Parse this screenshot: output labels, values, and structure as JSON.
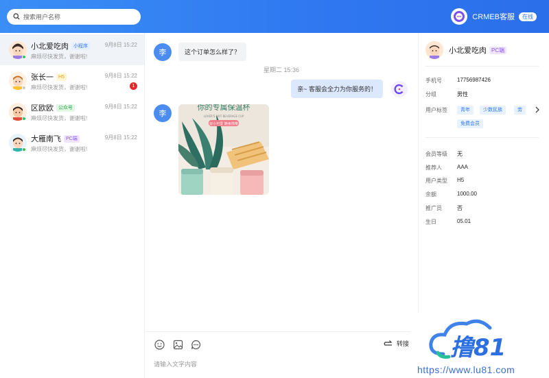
{
  "search": {
    "placeholder": "搜索用户名称"
  },
  "brand": {
    "name": "CRMEB客服",
    "status": "在线"
  },
  "conversations": [
    {
      "name": "小北爱吃肉",
      "tag": "小程序",
      "time": "9月8日 15:22",
      "msg": "麻烦尽快发货，谢谢啦!",
      "status_color": "#2ec45c"
    },
    {
      "name": "张长一",
      "tag": "H5",
      "time": "9月8日 15:22",
      "msg": "麻烦尽快发货，谢谢啦!",
      "badge": "1",
      "status_color": "#c8c8c8"
    },
    {
      "name": "区欧欧",
      "tag": "公众号",
      "time": "9月8日 15:22",
      "msg": "麻烦尽快发货，谢谢啦!",
      "status_color": "#2ec45c"
    },
    {
      "name": "大雁南飞",
      "tag": "PC端",
      "time": "9月8日 15:22",
      "msg": "麻烦尽快发货，谢谢啦!",
      "status_color": "#2ec45c"
    }
  ],
  "chat": {
    "user_initial": "李",
    "msg1": "这个订单怎么样了？",
    "time_divider": "星期二 15:36",
    "msg2": "亲~ 客服会全力为你服务的！",
    "image_title": "你的专属保温杯",
    "image_subtitle": "LOVER'S HOT BEVERAGE CUP",
    "image_badge": "好小可爱 随身携带",
    "input_placeholder": "请输入文字内容",
    "transfer_label": "转接"
  },
  "profile": {
    "name": "小北爱吃肉",
    "tag": "PC端",
    "fields": [
      {
        "label": "手机号",
        "value": "17756987426"
      },
      {
        "label": "分组",
        "value": "男性"
      },
      {
        "label": "用户标签",
        "value": ""
      }
    ],
    "tags": [
      "青年",
      "少数民族",
      "劳",
      "免费会员"
    ],
    "details": [
      {
        "label": "会员等级",
        "value": "无"
      },
      {
        "label": "推荐人",
        "value": "AAA"
      },
      {
        "label": "用户类型",
        "value": "H5"
      },
      {
        "label": "余额",
        "value": "1000.00"
      },
      {
        "label": "推广员",
        "value": "否"
      },
      {
        "label": "生日",
        "value": "05.01"
      }
    ]
  },
  "watermark": {
    "logo_text": "撸81",
    "url": "https://www.lu81.com"
  },
  "colors": {
    "primary": "#2f77f0",
    "online": "#2ec45c",
    "badge": "#e62828"
  }
}
